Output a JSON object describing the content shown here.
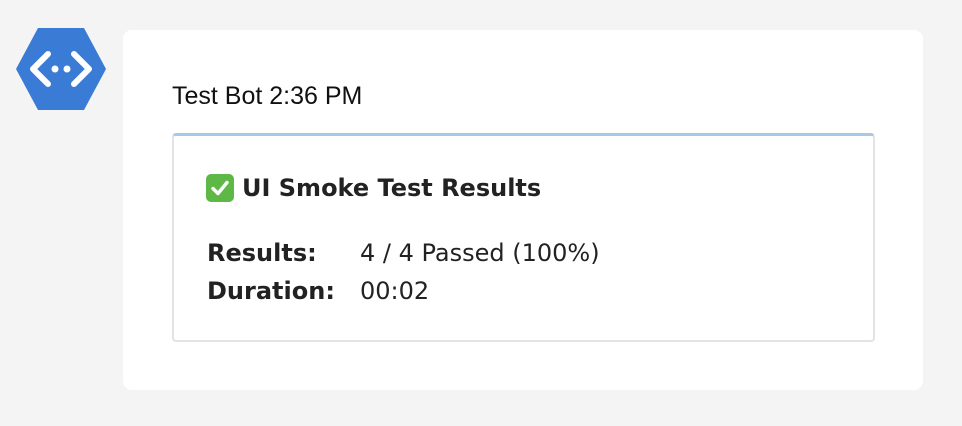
{
  "message": {
    "sender": "Test Bot",
    "time": "2:36 PM"
  },
  "card": {
    "title": "UI Smoke Test Results",
    "title_icon": "check-box-icon",
    "facts": [
      {
        "label": "Results:",
        "value": "4 / 4 Passed (100%)"
      },
      {
        "label": "Duration:",
        "value": "00:02"
      }
    ]
  },
  "colors": {
    "avatar": "#3a7bd5",
    "card_accent": "#a9c8e6",
    "check": "#5eb845",
    "background": "#f4f4f4"
  }
}
